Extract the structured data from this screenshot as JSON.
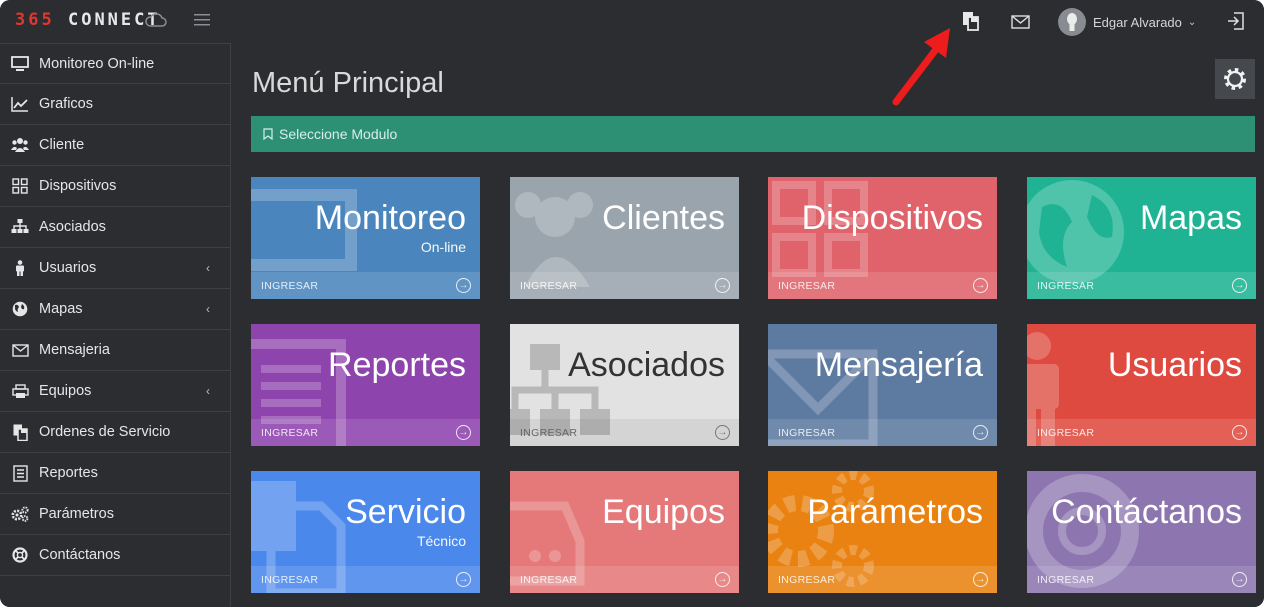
{
  "app": {
    "logo_num": "365",
    "logo_text": "CONNECT"
  },
  "header": {
    "user_name": "Edgar Alvarado"
  },
  "sidebar": {
    "items": [
      {
        "label": "Monitoreo On-line",
        "icon": "monitor-icon"
      },
      {
        "label": "Graficos",
        "icon": "line-chart-icon"
      },
      {
        "label": "Cliente",
        "icon": "users-icon"
      },
      {
        "label": "Dispositivos",
        "icon": "grid-icon"
      },
      {
        "label": "Asociados",
        "icon": "sitemap-icon"
      },
      {
        "label": "Usuarios",
        "icon": "user-icon"
      },
      {
        "label": "Mapas",
        "icon": "globe-icon"
      },
      {
        "label": "Mensajeria",
        "icon": "envelope-icon"
      },
      {
        "label": "Equipos",
        "icon": "printer-icon"
      },
      {
        "label": "Ordenes de Servicio",
        "icon": "copy-icon"
      },
      {
        "label": "Reportes",
        "icon": "list-icon"
      },
      {
        "label": "Parámetros",
        "icon": "cogs-icon"
      },
      {
        "label": "Contáctanos",
        "icon": "lifebuoy-icon"
      }
    ]
  },
  "main": {
    "title": "Menú Principal",
    "banner": "Seleccione Modulo",
    "tile_footer": "INGRESAR",
    "tiles": [
      {
        "title": "Monitoreo",
        "subtitle": "On-line"
      },
      {
        "title": "Clientes",
        "subtitle": ""
      },
      {
        "title": "Dispositivos",
        "subtitle": ""
      },
      {
        "title": "Mapas",
        "subtitle": ""
      },
      {
        "title": "Reportes",
        "subtitle": ""
      },
      {
        "title": "Asociados",
        "subtitle": ""
      },
      {
        "title": "Mensajería",
        "subtitle": ""
      },
      {
        "title": "Usuarios",
        "subtitle": ""
      },
      {
        "title": "Servicio",
        "subtitle": "Técnico"
      },
      {
        "title": "Equipos",
        "subtitle": ""
      },
      {
        "title": "Parámetros",
        "subtitle": ""
      },
      {
        "title": "Contáctanos",
        "subtitle": ""
      }
    ]
  },
  "colors": {
    "background": "#2b2d31",
    "banner": "#2d8f73",
    "monitoreo": "#4a86bd",
    "clientes": "#9aa4ad",
    "dispositivos": "#e0626a",
    "mapas": "#1fb394",
    "reportes": "#8e44ad",
    "asociados": "#e2e2e2",
    "mensajeria": "#5d7aa1",
    "usuarios": "#de4a3f",
    "servicio": "#4a88ec",
    "equipos": "#e57879",
    "parametros": "#e98211",
    "contactanos": "#8d76b0",
    "annotation_arrow": "#ee1c1c"
  }
}
